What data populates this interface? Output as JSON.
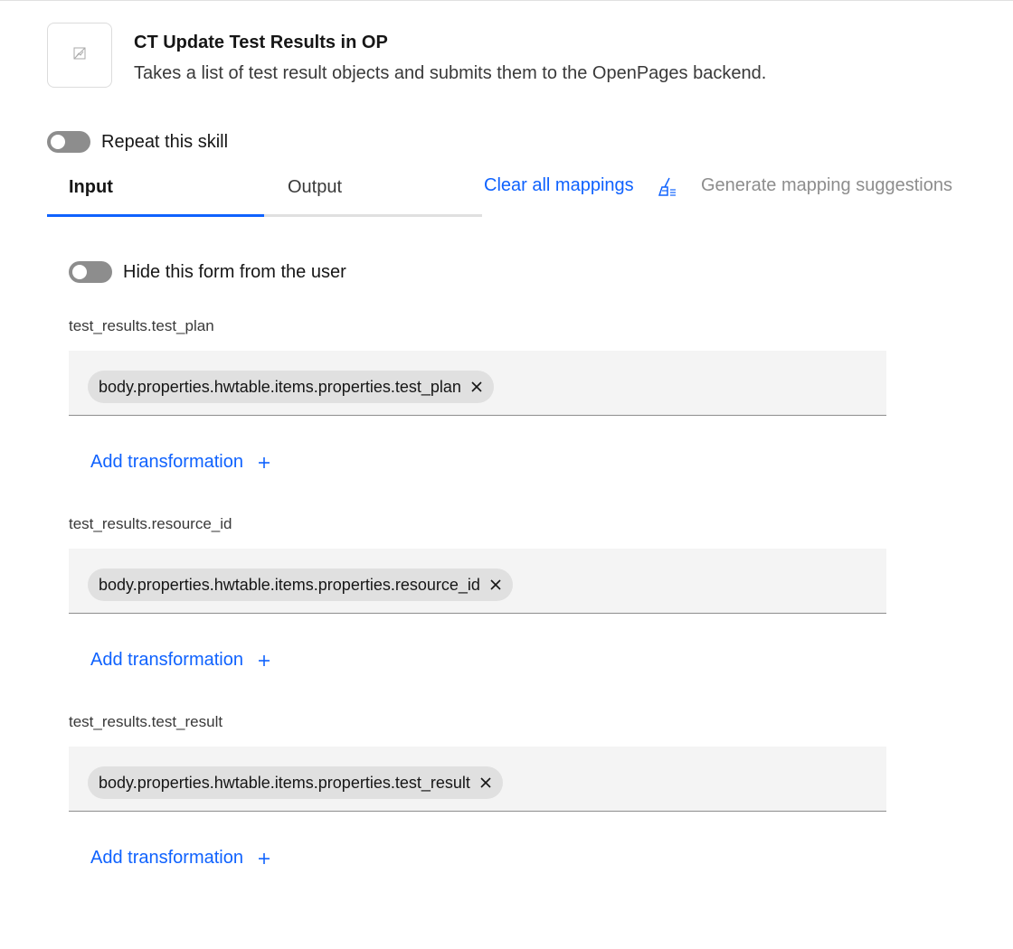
{
  "header": {
    "title": "CT Update Test Results in OP",
    "description": "Takes a list of test result objects and submits them to the OpenPages backend.",
    "icon": "broken-image-icon"
  },
  "repeat_toggle": {
    "label": "Repeat this skill",
    "on": false
  },
  "tabs": [
    {
      "label": "Input",
      "active": true
    },
    {
      "label": "Output",
      "active": false
    }
  ],
  "actions": {
    "clear_mappings": "Clear all mappings",
    "clear_icon": "broom-icon",
    "generate_suggestions": "Generate mapping suggestions"
  },
  "hide_form_toggle": {
    "label": "Hide this form from the user",
    "on": false
  },
  "fields": [
    {
      "label": "test_results.test_plan",
      "chip": "body.properties.hwtable.items.properties.test_plan",
      "add_transformation": "Add transformation"
    },
    {
      "label": "test_results.resource_id",
      "chip": "body.properties.hwtable.items.properties.resource_id",
      "add_transformation": "Add transformation"
    },
    {
      "label": "test_results.test_result",
      "chip": "body.properties.hwtable.items.properties.test_result",
      "add_transformation": "Add transformation"
    }
  ],
  "colors": {
    "link": "#0f62fe",
    "toggle_off": "#8d8d8d",
    "field_bg": "#f4f4f4",
    "chip_bg": "#e0e0e0",
    "disabled_text": "#8d8d8d"
  }
}
